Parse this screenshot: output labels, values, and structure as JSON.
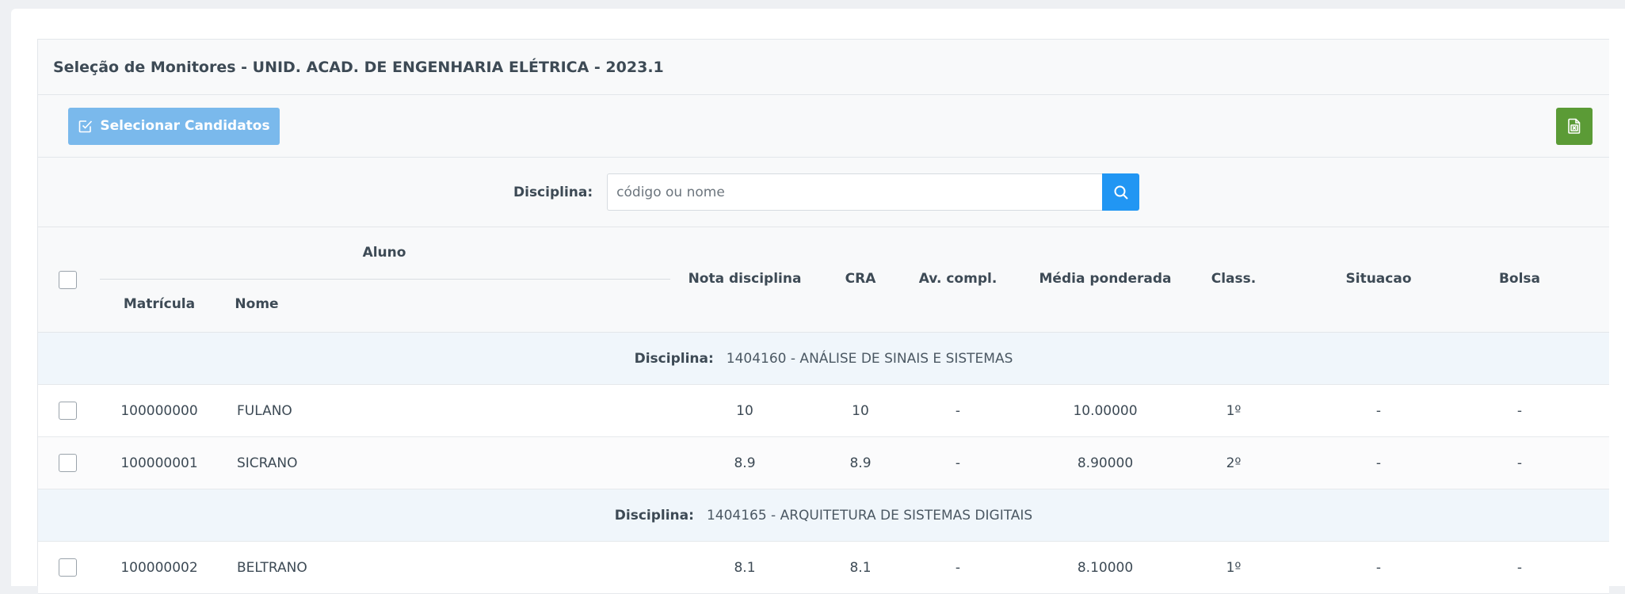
{
  "panel": {
    "title": "Seleção de Monitores - UNID. ACAD. DE ENGENHARIA ELÉTRICA - 2023.1"
  },
  "toolbar": {
    "select_label": "Selecionar Candidatos",
    "select_icon": "checkbox-edit-icon",
    "export_icon": "excel-file-icon",
    "export_color": "#5b9b36",
    "select_color": "#7ab9ec"
  },
  "search": {
    "label": "Disciplina:",
    "placeholder": "código ou nome",
    "value": "",
    "button_icon": "search-icon",
    "button_color": "#2196f3"
  },
  "table": {
    "headers": {
      "aluno": "Aluno",
      "matricula": "Matrícula",
      "nome": "Nome",
      "nota": "Nota disciplina",
      "cra": "CRA",
      "av_compl": "Av. compl.",
      "media": "Média ponderada",
      "class": "Class.",
      "situacao": "Situacao",
      "bolsa": "Bolsa"
    },
    "group_label": "Disciplina:",
    "groups": [
      {
        "disciplina": "1404160 - ANÁLISE DE SINAIS E SISTEMAS",
        "rows": [
          {
            "matricula": "100000000",
            "nome": "FULANO",
            "nota": "10",
            "cra": "10",
            "av_compl": "-",
            "media": "10.00000",
            "class": "1º",
            "situacao": "-",
            "bolsa": "-"
          },
          {
            "matricula": "100000001",
            "nome": "SICRANO",
            "nota": "8.9",
            "cra": "8.9",
            "av_compl": "-",
            "media": "8.90000",
            "class": "2º",
            "situacao": "-",
            "bolsa": "-"
          }
        ]
      },
      {
        "disciplina": "1404165 - ARQUITETURA DE SISTEMAS DIGITAIS",
        "rows": [
          {
            "matricula": "100000002",
            "nome": "BELTRANO",
            "nota": "8.1",
            "cra": "8.1",
            "av_compl": "-",
            "media": "8.10000",
            "class": "1º",
            "situacao": "-",
            "bolsa": "-"
          }
        ]
      }
    ]
  }
}
